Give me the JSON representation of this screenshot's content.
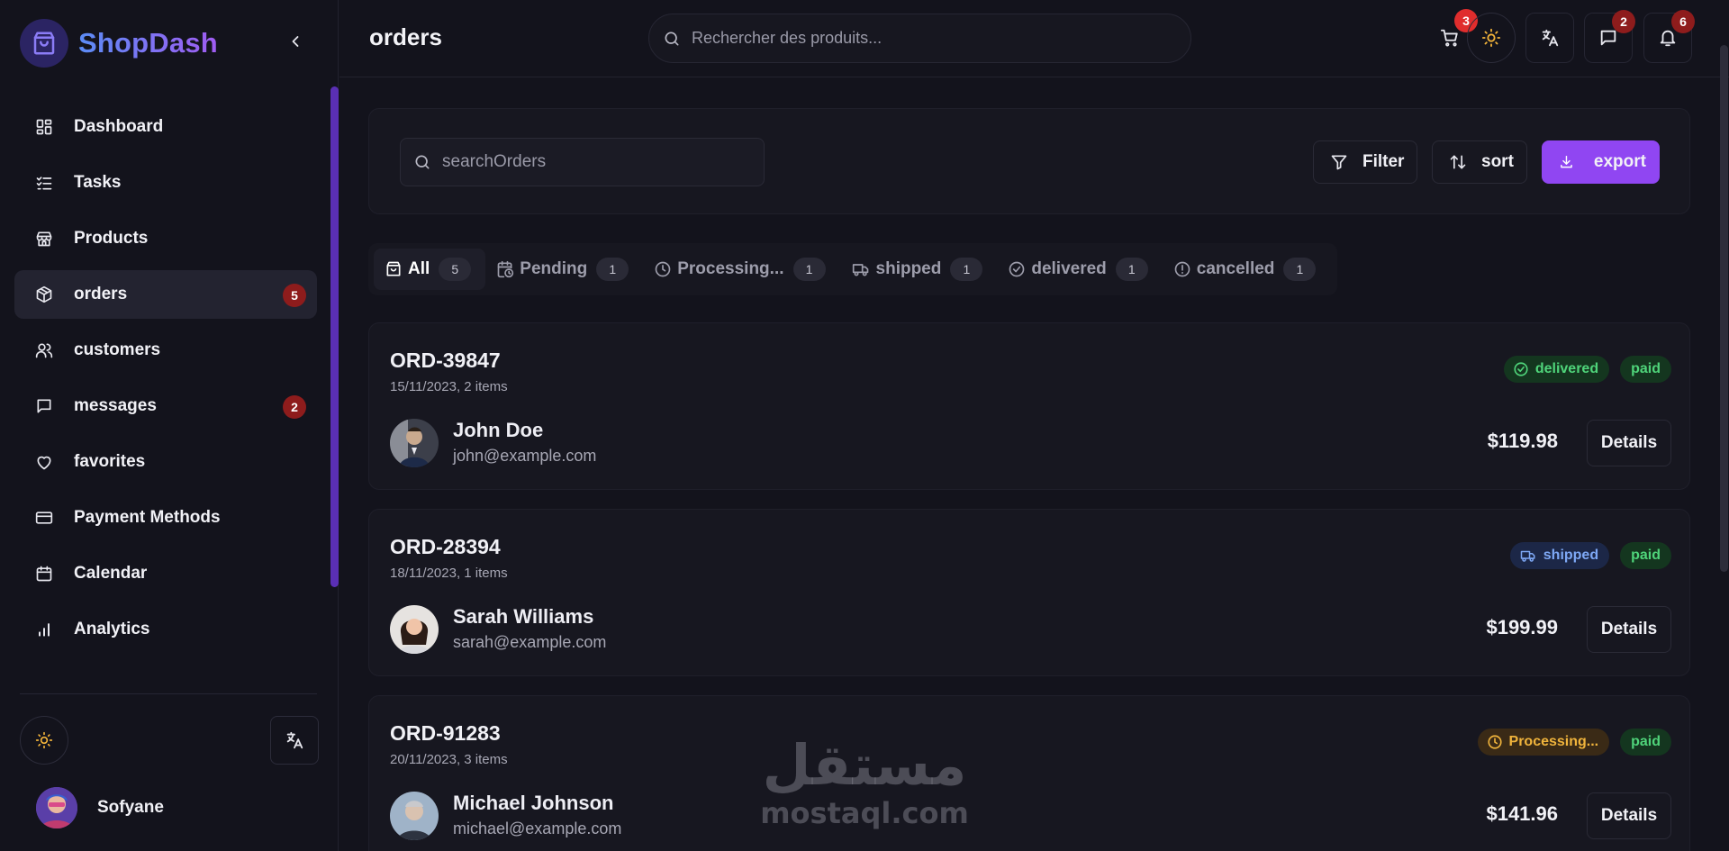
{
  "brand": {
    "name": "ShopDash",
    "accent": "#9046f2"
  },
  "sidebar": {
    "items": [
      {
        "label": "Dashboard",
        "icon": "dashboard-icon"
      },
      {
        "label": "Tasks",
        "icon": "tasks-icon"
      },
      {
        "label": "Products",
        "icon": "store-icon"
      },
      {
        "label": "orders",
        "icon": "package-icon",
        "active": true,
        "badge": "5"
      },
      {
        "label": "customers",
        "icon": "users-icon"
      },
      {
        "label": "messages",
        "icon": "message-icon",
        "badge": "2"
      },
      {
        "label": "favorites",
        "icon": "heart-icon"
      },
      {
        "label": "Payment Methods",
        "icon": "credit-card-icon"
      },
      {
        "label": "Calendar",
        "icon": "calendar-icon"
      },
      {
        "label": "Analytics",
        "icon": "bar-chart-icon"
      }
    ],
    "user": {
      "name": "Sofyane"
    }
  },
  "header": {
    "title": "orders",
    "search_placeholder": "Rechercher des produits...",
    "cart_badge": "3",
    "messages_badge": "2",
    "notifications_badge": "6"
  },
  "toolbar": {
    "search_placeholder": "searchOrders",
    "filter_label": "Filter",
    "sort_label": "sort",
    "export_label": "export"
  },
  "tabs": [
    {
      "label": "All",
      "count": "5",
      "icon": "bag-icon",
      "active": true
    },
    {
      "label": "Pending",
      "count": "1",
      "icon": "calendar-clock-icon"
    },
    {
      "label": "Processing...",
      "count": "1",
      "icon": "clock-icon"
    },
    {
      "label": "shipped",
      "count": "1",
      "icon": "truck-icon"
    },
    {
      "label": "delivered",
      "count": "1",
      "icon": "check-circle-icon"
    },
    {
      "label": "cancelled",
      "count": "1",
      "icon": "alert-circle-icon"
    }
  ],
  "orders": [
    {
      "id": "ORD-39847",
      "meta": "15/11/2023, 2 items",
      "customer": "John Doe",
      "email": "john@example.com",
      "status": "delivered",
      "status_color": "#4fd47a",
      "status_bg": "#14361f",
      "payment": "paid",
      "total": "$119.98",
      "details_label": "Details"
    },
    {
      "id": "ORD-28394",
      "meta": "18/11/2023, 1 items",
      "customer": "Sarah Williams",
      "email": "sarah@example.com",
      "status": "shipped",
      "status_color": "#7ea8f5",
      "status_bg": "#1c2747",
      "payment": "paid",
      "total": "$199.99",
      "details_label": "Details"
    },
    {
      "id": "ORD-91283",
      "meta": "20/11/2023, 3 items",
      "customer": "Michael Johnson",
      "email": "michael@example.com",
      "status": "Processing...",
      "status_color": "#f0b43c",
      "status_bg": "#3a2a16",
      "payment": "paid",
      "total": "$141.96",
      "details_label": "Details"
    }
  ],
  "watermark": {
    "arabic": "مستقل",
    "latin": "mostaql.com"
  }
}
